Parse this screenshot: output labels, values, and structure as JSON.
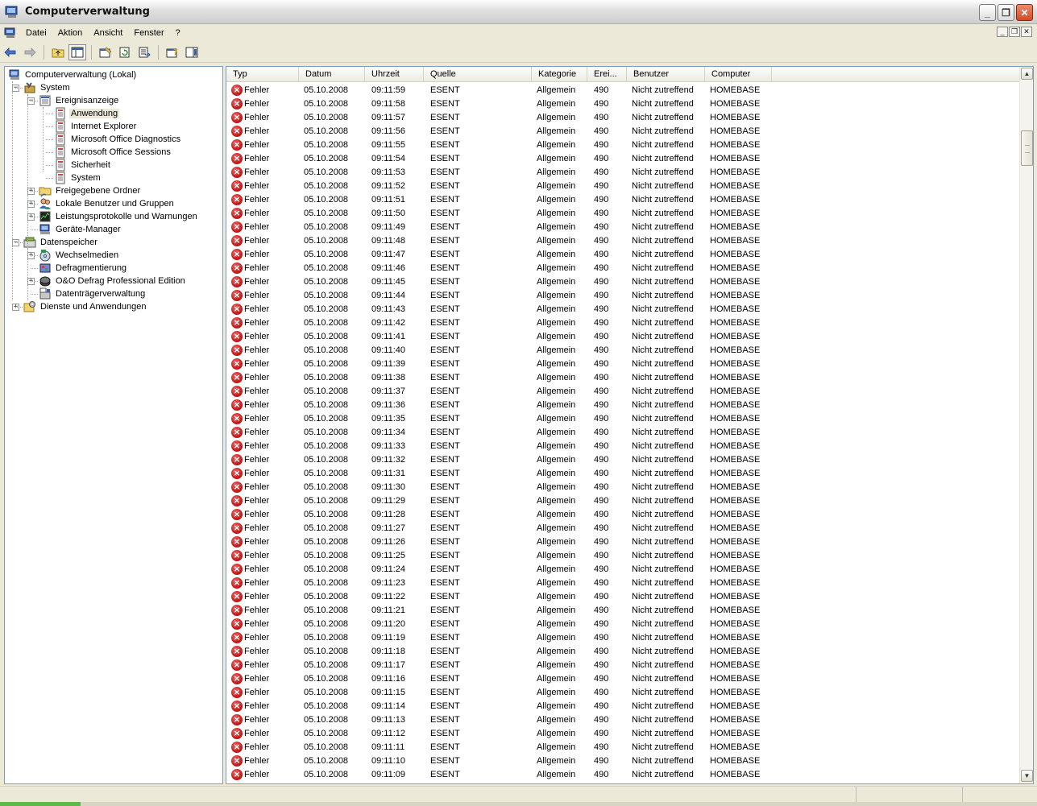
{
  "window": {
    "title": "Computerverwaltung"
  },
  "menu": [
    "Datei",
    "Aktion",
    "Ansicht",
    "Fenster",
    "?"
  ],
  "toolbar": [
    "back-icon",
    "forward-icon",
    "up-folder-icon",
    "show-tree-icon",
    "properties-icon",
    "refresh-icon",
    "export-list-icon",
    "help-icon",
    "action-pane-icon"
  ],
  "tree": [
    {
      "label": "Computerverwaltung (Lokal)",
      "level": 0,
      "icon": "computer-icon",
      "expander": ""
    },
    {
      "label": "System",
      "level": 1,
      "icon": "tools-icon",
      "expander": "-"
    },
    {
      "label": "Ereignisanzeige",
      "level": 2,
      "icon": "event-viewer-icon",
      "expander": "-"
    },
    {
      "label": "Anwendung",
      "level": 3,
      "icon": "log-icon",
      "expander": "",
      "selected": true
    },
    {
      "label": "Internet Explorer",
      "level": 3,
      "icon": "log-icon",
      "expander": ""
    },
    {
      "label": "Microsoft Office Diagnostics",
      "level": 3,
      "icon": "log-icon",
      "expander": ""
    },
    {
      "label": "Microsoft Office Sessions",
      "level": 3,
      "icon": "log-icon",
      "expander": ""
    },
    {
      "label": "Sicherheit",
      "level": 3,
      "icon": "log-icon",
      "expander": ""
    },
    {
      "label": "System",
      "level": 3,
      "icon": "log-icon",
      "expander": ""
    },
    {
      "label": "Freigegebene Ordner",
      "level": 2,
      "icon": "shared-folder-icon",
      "expander": "+"
    },
    {
      "label": "Lokale Benutzer und Gruppen",
      "level": 2,
      "icon": "users-icon",
      "expander": "+"
    },
    {
      "label": "Leistungsprotokolle und Warnungen",
      "level": 2,
      "icon": "performance-icon",
      "expander": "+"
    },
    {
      "label": "Geräte-Manager",
      "level": 2,
      "icon": "device-manager-icon",
      "expander": ""
    },
    {
      "label": "Datenspeicher",
      "level": 1,
      "icon": "storage-icon",
      "expander": "-"
    },
    {
      "label": "Wechselmedien",
      "level": 2,
      "icon": "removable-media-icon",
      "expander": "+"
    },
    {
      "label": "Defragmentierung",
      "level": 2,
      "icon": "defrag-icon",
      "expander": ""
    },
    {
      "label": "O&O Defrag Professional Edition",
      "level": 2,
      "icon": "oo-defrag-icon",
      "expander": "+"
    },
    {
      "label": "Datenträgerverwaltung",
      "level": 2,
      "icon": "disk-management-icon",
      "expander": ""
    },
    {
      "label": "Dienste und Anwendungen",
      "level": 1,
      "icon": "services-icon",
      "expander": "+"
    }
  ],
  "columns": [
    "Typ",
    "Datum",
    "Uhrzeit",
    "Quelle",
    "Kategorie",
    "Erei...",
    "Benutzer",
    "Computer"
  ],
  "row_defaults": {
    "type": "Fehler",
    "date": "05.10.2008",
    "source": "ESENT",
    "category": "Allgemein",
    "event": "490",
    "user": "Nicht zutreffend",
    "computer": "HOMEBASE"
  },
  "times": [
    "09:11:59",
    "09:11:58",
    "09:11:57",
    "09:11:56",
    "09:11:55",
    "09:11:54",
    "09:11:53",
    "09:11:52",
    "09:11:51",
    "09:11:50",
    "09:11:49",
    "09:11:48",
    "09:11:47",
    "09:11:46",
    "09:11:45",
    "09:11:44",
    "09:11:43",
    "09:11:42",
    "09:11:41",
    "09:11:40",
    "09:11:39",
    "09:11:38",
    "09:11:37",
    "09:11:36",
    "09:11:35",
    "09:11:34",
    "09:11:33",
    "09:11:32",
    "09:11:31",
    "09:11:30",
    "09:11:29",
    "09:11:28",
    "09:11:27",
    "09:11:26",
    "09:11:25",
    "09:11:24",
    "09:11:23",
    "09:11:22",
    "09:11:21",
    "09:11:20",
    "09:11:19",
    "09:11:18",
    "09:11:17",
    "09:11:16",
    "09:11:15",
    "09:11:14",
    "09:11:13",
    "09:11:12",
    "09:11:11",
    "09:11:10",
    "09:11:09"
  ]
}
